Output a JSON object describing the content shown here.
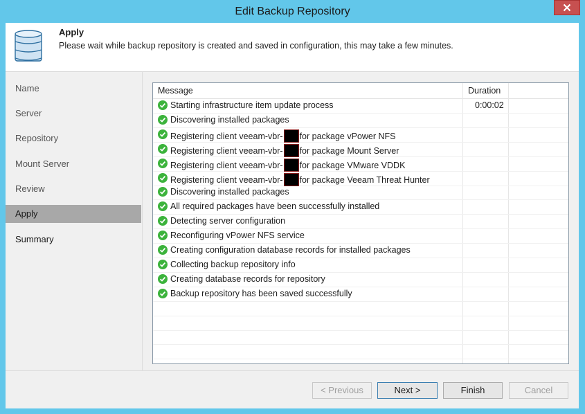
{
  "window": {
    "title": "Edit Backup Repository",
    "close_glyph": "✕"
  },
  "header": {
    "title": "Apply",
    "description": "Please wait while backup repository is created and saved in configuration, this may take a few minutes."
  },
  "nav": {
    "items": [
      {
        "label": "Name"
      },
      {
        "label": "Server"
      },
      {
        "label": "Repository"
      },
      {
        "label": "Mount Server"
      },
      {
        "label": "Review"
      },
      {
        "label": "Apply"
      },
      {
        "label": "Summary"
      }
    ],
    "active": "Apply"
  },
  "log": {
    "columns": {
      "message": "Message",
      "duration": "Duration"
    },
    "rows": [
      {
        "text": "Starting infrastructure item update process",
        "duration": "0:00:02"
      },
      {
        "text": "Discovering installed packages",
        "duration": ""
      },
      {
        "pre": "Registering client veeam-vbr-",
        "post": "for package vPower NFS",
        "duration": ""
      },
      {
        "pre": "Registering client veeam-vbr-",
        "post": "for package Mount Server",
        "duration": ""
      },
      {
        "pre": "Registering client veeam-vbr-",
        "post": "for package VMware VDDK",
        "duration": ""
      },
      {
        "pre": "Registering client veeam-vbr-",
        "post": "for package Veeam Threat Hunter",
        "duration": ""
      },
      {
        "text": "Discovering installed packages",
        "duration": ""
      },
      {
        "text": "All required packages have been successfully installed",
        "duration": ""
      },
      {
        "text": "Detecting server configuration",
        "duration": ""
      },
      {
        "text": "Reconfiguring vPower NFS service",
        "duration": ""
      },
      {
        "text": "Creating configuration database records for installed packages",
        "duration": ""
      },
      {
        "text": "Collecting backup repository info",
        "duration": ""
      },
      {
        "text": "Creating database records for repository",
        "duration": ""
      },
      {
        "text": "Backup repository has been saved successfully",
        "duration": ""
      }
    ]
  },
  "buttons": {
    "previous": "< Previous",
    "next": "Next >",
    "finish": "Finish",
    "cancel": "Cancel"
  },
  "colors": {
    "titlebar": "#62c7ea",
    "success": "#3cb33c",
    "close": "#c75050",
    "nav_active": "#a8a8a8"
  }
}
